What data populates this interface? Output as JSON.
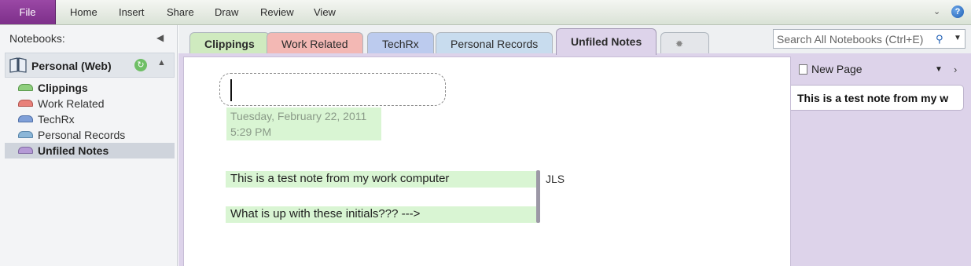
{
  "ribbon": {
    "file_label": "File",
    "tabs": [
      "Home",
      "Insert",
      "Share",
      "Draw",
      "Review",
      "View"
    ],
    "help_label": "?"
  },
  "nav": {
    "header": "Notebooks:",
    "notebook_name": "Personal (Web)",
    "sections": [
      {
        "label": "Clippings",
        "color": "#8fcf7e"
      },
      {
        "label": "Work Related",
        "color": "#e8807a"
      },
      {
        "label": "TechRx",
        "color": "#7f9fd8"
      },
      {
        "label": "Personal Records",
        "color": "#8bb6d8"
      },
      {
        "label": "Unfiled Notes",
        "color": "#b59ad6"
      }
    ]
  },
  "section_tabs": [
    {
      "label": "Clippings",
      "color": "#cfeabf"
    },
    {
      "label": "Work Related",
      "color": "#f3b8b4"
    },
    {
      "label": "TechRx",
      "color": "#bccbee"
    },
    {
      "label": "Personal Records",
      "color": "#c8dcee"
    },
    {
      "label": "Unfiled Notes",
      "color": "#ddd3ea"
    }
  ],
  "search": {
    "placeholder": "Search All Notebooks (Ctrl+E)"
  },
  "note": {
    "date": "Tuesday, February 22, 2011",
    "time": "5:29 PM",
    "lines": [
      "This is a test note from my work computer",
      "What is up with these initials??? --->"
    ],
    "initials": "JLS"
  },
  "page_list": {
    "new_page_label": "New Page",
    "pages": [
      "This is a test note from my w"
    ]
  }
}
